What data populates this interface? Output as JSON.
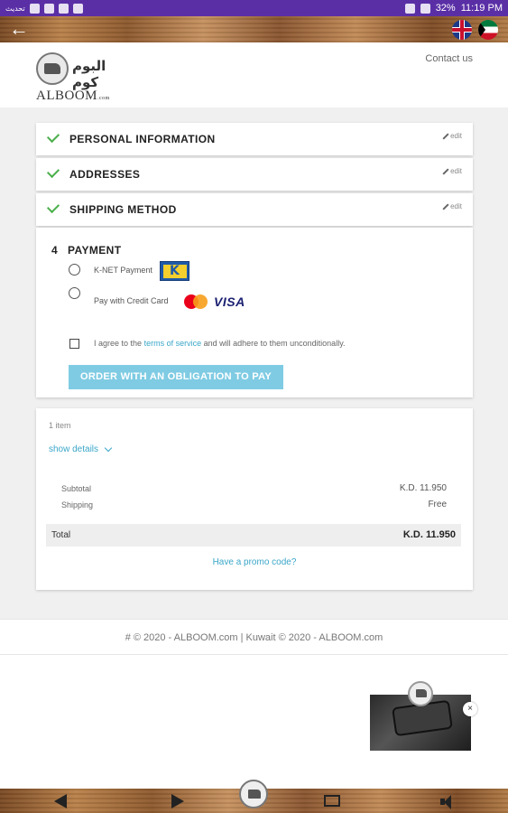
{
  "statusbar": {
    "left_label": "تحديث",
    "battery": "32%",
    "time": "11:19 PM"
  },
  "header": {
    "logo_ar": "البوم كوم",
    "logo_en": "ALBOOM",
    "logo_en_suffix": ".com",
    "contact": "Contact us"
  },
  "steps": [
    {
      "title": "PERSONAL INFORMATION",
      "edit": "edit"
    },
    {
      "title": "ADDRESSES",
      "edit": "edit"
    },
    {
      "title": "SHIPPING METHOD",
      "edit": "edit"
    }
  ],
  "payment": {
    "number": "4",
    "title": "PAYMENT",
    "knet_label": "K-NET Payment",
    "knet_logo_letter": "K",
    "credit_label": "Pay with Credit Card",
    "visa": "VISA",
    "agree_prefix": "I agree to the",
    "agree_link": "terms of service",
    "agree_suffix": "and will adhere to them unconditionally.",
    "order_button": "ORDER WITH AN OBLIGATION TO PAY"
  },
  "summary": {
    "items_count": "1 item",
    "show_details": "show details",
    "subtotal_label": "Subtotal",
    "subtotal_value": "K.D. 11.950",
    "shipping_label": "Shipping",
    "shipping_value": "Free",
    "total_label": "Total",
    "total_value": "K.D. 11.950",
    "promo": "Have a promo code?"
  },
  "footer": {
    "text": "# © 2020 - ALBOOM.com | Kuwait © 2020 - ALBOOM.com"
  },
  "video": {
    "close": "×"
  },
  "colors": {
    "statusbar": "#5a2fa6",
    "accent": "#3aa6c8",
    "button": "#7fcbe3",
    "check": "#4cb04c"
  },
  "icons": {
    "back": "arrow-left-icon",
    "edit": "pencil-icon",
    "check": "checkmark-icon"
  }
}
